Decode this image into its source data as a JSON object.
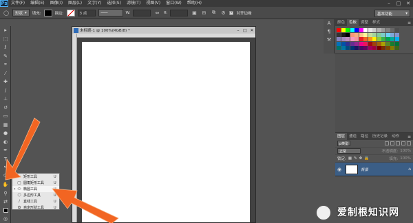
{
  "menubar": {
    "logo": "Ps",
    "items": [
      "文件(F)",
      "编辑(E)",
      "图像(I)",
      "图层(L)",
      "文字(Y)",
      "选择(S)",
      "滤镜(T)",
      "视图(V)",
      "窗口(W)",
      "帮助(H)"
    ],
    "minimize": "–",
    "restore": "□",
    "close": "✕"
  },
  "options": {
    "shape_mode": "形状",
    "fill_label": "填充:",
    "stroke_label": "描边:",
    "stroke_width": "3 点",
    "w_label": "W:",
    "h_label": "H:",
    "align_edges": "对齐边缘",
    "workspace": "基本功能"
  },
  "document": {
    "title": "未标题-1 @ 100%(RGB/8) *"
  },
  "flyout": {
    "items": [
      {
        "label": "矩形工具",
        "key": "U",
        "selected": false
      },
      {
        "label": "圆角矩形工具",
        "key": "U",
        "selected": false
      },
      {
        "label": "椭圆工具",
        "key": "U",
        "selected": true
      },
      {
        "label": "多边形工具",
        "key": "U",
        "selected": false
      },
      {
        "label": "直线工具",
        "key": "U",
        "selected": false
      },
      {
        "label": "自定形状工具",
        "key": "U",
        "selected": false
      }
    ]
  },
  "swatches_panel": {
    "tabs": [
      "颜色",
      "色板",
      "调整",
      "样式"
    ],
    "active_tab": "色板"
  },
  "layers_panel": {
    "tabs": [
      "图层",
      "通道",
      "路径",
      "历史记录",
      "动作"
    ],
    "active_tab": "图层",
    "kind_filter": "ρ类型",
    "blend_mode": "正常",
    "opacity_label": "不透明度:",
    "opacity_value": "100%",
    "lock_label": "锁定:",
    "fill_label": "填充:",
    "fill_value": "100%",
    "layer_name": "背景"
  },
  "watermark": {
    "text": "爱制根知识网"
  },
  "colors": {
    "accent_arrow": "#f26522",
    "layer_selected": "#3b5e86",
    "swatches": [
      "#ff0000",
      "#ffff00",
      "#00ff00",
      "#00ffff",
      "#0000ff",
      "#ff00ff",
      "#ffffff",
      "#e6e6e6",
      "#cccccc",
      "#b3b3b3",
      "#999999",
      "#808080",
      "#666666",
      "#4d4d4d",
      "#333333",
      "#1a1a1a",
      "#000000",
      "#f7977a",
      "#f9ad81",
      "#fdc68a",
      "#fff79a",
      "#c4df9b",
      "#a2d39c",
      "#82ca9d",
      "#7bcdc8",
      "#6ecff6",
      "#7ea7d8",
      "#8493ca",
      "#8882be",
      "#a187be",
      "#bc8dbf",
      "#f49ac2",
      "#f6989d",
      "#ed1c24",
      "#f26522",
      "#f7941d",
      "#fff200",
      "#8dc73f",
      "#39b54a",
      "#00a651",
      "#00a99d",
      "#00aeef",
      "#0072bc",
      "#0054a6",
      "#2e3192",
      "#662d91",
      "#92278f",
      "#ec008c",
      "#ed145b",
      "#9e0b0f",
      "#a0410d",
      "#a36209",
      "#aba000",
      "#598527",
      "#197b30",
      "#007236",
      "#00746b",
      "#0076a3",
      "#004b80",
      "#003471",
      "#1b1464",
      "#440e62",
      "#630460",
      "#9e005d",
      "#9e0039",
      "#790000",
      "#7b2e00",
      "#7d4900",
      "#827b00",
      "#406618"
    ]
  }
}
